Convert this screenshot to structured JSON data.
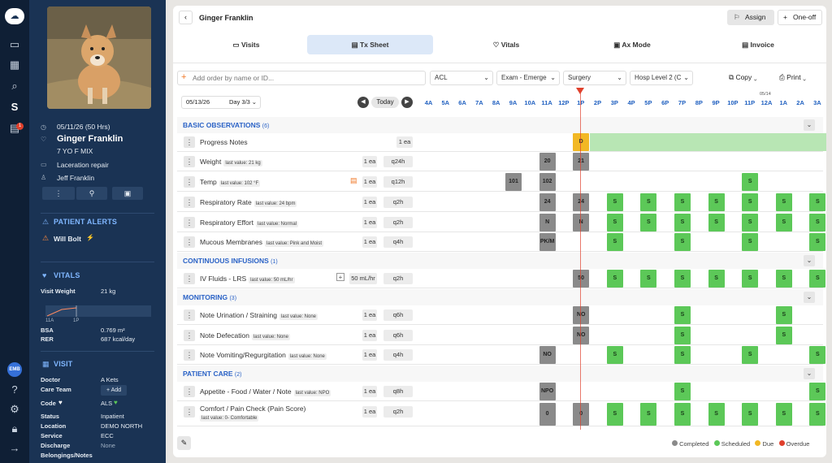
{
  "patient": {
    "datetime": "05/11/26 (50 Hrs)",
    "name": "Ginger Franklin",
    "descriptor": "7 YO F MIX",
    "reason": "Laceration repair",
    "owner": "Jeff Franklin"
  },
  "rail": {
    "badge": "1",
    "user_initials": "EMB"
  },
  "alerts": {
    "title": "PATIENT ALERTS",
    "item": "Will Bolt"
  },
  "vitals": {
    "title": "VITALS",
    "visit_weight_label": "Visit Weight",
    "visit_weight": "21 kg",
    "chart_x": [
      "11A",
      "1P"
    ],
    "bsa_label": "BSA",
    "bsa": "0.769 m²",
    "rer_label": "RER",
    "rer": "687 kcal/day"
  },
  "visit": {
    "title": "VISIT",
    "doctor_label": "Doctor",
    "doctor": "A Kets",
    "careteam_label": "Care Team",
    "careteam_btn": "+ Add",
    "code_label": "Code",
    "code": "ALS",
    "status_label": "Status",
    "status": "Inpatient",
    "location_label": "Location",
    "location": "DEMO NORTH",
    "service_label": "Service",
    "service": "ECC",
    "discharge_label": "Discharge",
    "discharge": "None",
    "belongings_label": "Belongings/Notes"
  },
  "header": {
    "title": "Ginger Franklin",
    "assign": "Assign",
    "oneoff": "One-off"
  },
  "tabs": [
    "Visits",
    "Tx Sheet",
    "Vitals",
    "Ax Mode",
    "Invoice"
  ],
  "toolbar": {
    "add_placeholder": "Add order by name or ID...",
    "filters": [
      "ACL",
      "Exam - Emerge",
      "Surgery",
      "Hosp Level 2 (C"
    ],
    "copy": "Copy",
    "print": "Print"
  },
  "timeline": {
    "date": "05/13/26",
    "day": "Day 3/3",
    "today": "Today",
    "next_date": "05/14",
    "hours": [
      "4A",
      "5A",
      "6A",
      "7A",
      "8A",
      "9A",
      "10A",
      "11A",
      "12P",
      "1P",
      "2P",
      "3P",
      "4P",
      "5P",
      "6P",
      "7P",
      "8P",
      "9P",
      "10P",
      "11P",
      "12A",
      "1A",
      "2A",
      "3A"
    ]
  },
  "groups": [
    {
      "title": "BASIC OBSERVATIONS",
      "count": "(6)"
    },
    {
      "title": "CONTINUOUS INFUSIONS",
      "count": "(1)"
    },
    {
      "title": "MONITORING",
      "count": "(3)"
    },
    {
      "title": "PATIENT CARE",
      "count": "(2)"
    }
  ],
  "rows": [
    {
      "name": "Progress Notes",
      "last": "",
      "qty": "1 ea",
      "freq": ""
    },
    {
      "name": "Weight",
      "last": "last value: 21 kg",
      "qty": "1 ea",
      "freq": "q24h"
    },
    {
      "name": "Temp",
      "last": "last value: 102 °F",
      "qty": "1 ea",
      "freq": "q12h"
    },
    {
      "name": "Respiratory Rate",
      "last": "last value: 24 bpm",
      "qty": "1 ea",
      "freq": "q2h"
    },
    {
      "name": "Respiratory Effort",
      "last": "last value: Normal",
      "qty": "1 ea",
      "freq": "q2h"
    },
    {
      "name": "Mucous Membranes",
      "last": "last value: Pink and Moist",
      "qty": "1 ea",
      "freq": "q4h"
    },
    {
      "name": "IV Fluids - LRS",
      "last": "last value: 50 mL/hr",
      "qty": "50 mL/hr",
      "freq": "q2h"
    },
    {
      "name": "Note Urination / Straining",
      "last": "last value: None",
      "qty": "1 ea",
      "freq": "q6h"
    },
    {
      "name": "Note Defecation",
      "last": "last value: None",
      "qty": "1 ea",
      "freq": "q6h"
    },
    {
      "name": "Note Vomiting/Regurgitation",
      "last": "last value: None",
      "qty": "1 ea",
      "freq": "q4h"
    },
    {
      "name": "Appetite - Food / Water / Note",
      "last": "last value: NPO",
      "qty": "1 ea",
      "freq": "q8h"
    },
    {
      "name": "Comfort / Pain Check (Pain Score)",
      "last": "last value: 0- Comfortable",
      "qty": "1 ea",
      "freq": "q2h"
    }
  ],
  "cells": [
    [
      [
        9,
        "D",
        "due"
      ]
    ],
    [
      [
        7,
        "20",
        "done"
      ],
      [
        9,
        "21",
        "done"
      ]
    ],
    [
      [
        5,
        "101",
        "done"
      ],
      [
        7,
        "102",
        "done"
      ],
      [
        19,
        "S",
        "sch"
      ]
    ],
    [
      [
        7,
        "24",
        "done"
      ],
      [
        9,
        "24",
        "done"
      ],
      [
        11,
        "S",
        "sch"
      ],
      [
        13,
        "S",
        "sch"
      ],
      [
        15,
        "S",
        "sch"
      ],
      [
        17,
        "S",
        "sch"
      ],
      [
        19,
        "S",
        "sch"
      ],
      [
        21,
        "S",
        "sch"
      ],
      [
        23,
        "S",
        "sch"
      ]
    ],
    [
      [
        7,
        "N",
        "done"
      ],
      [
        9,
        "N",
        "done"
      ],
      [
        11,
        "S",
        "sch"
      ],
      [
        13,
        "S",
        "sch"
      ],
      [
        15,
        "S",
        "sch"
      ],
      [
        17,
        "S",
        "sch"
      ],
      [
        19,
        "S",
        "sch"
      ],
      [
        21,
        "S",
        "sch"
      ],
      [
        23,
        "S",
        "sch"
      ]
    ],
    [
      [
        7,
        "PK/M",
        "done"
      ],
      [
        11,
        "S",
        "sch"
      ],
      [
        15,
        "S",
        "sch"
      ],
      [
        19,
        "S",
        "sch"
      ],
      [
        23,
        "S",
        "sch"
      ]
    ],
    [
      [
        9,
        "50",
        "done"
      ],
      [
        11,
        "S",
        "sch"
      ],
      [
        13,
        "S",
        "sch"
      ],
      [
        15,
        "S",
        "sch"
      ],
      [
        17,
        "S",
        "sch"
      ],
      [
        19,
        "S",
        "sch"
      ],
      [
        21,
        "S",
        "sch"
      ],
      [
        23,
        "S",
        "sch"
      ]
    ],
    [
      [
        9,
        "NO",
        "done"
      ],
      [
        15,
        "S",
        "sch"
      ],
      [
        21,
        "S",
        "sch"
      ]
    ],
    [
      [
        9,
        "NO",
        "done"
      ],
      [
        15,
        "S",
        "sch"
      ],
      [
        21,
        "S",
        "sch"
      ]
    ],
    [
      [
        7,
        "NO",
        "done"
      ],
      [
        11,
        "S",
        "sch"
      ],
      [
        15,
        "S",
        "sch"
      ],
      [
        19,
        "S",
        "sch"
      ],
      [
        23,
        "S",
        "sch"
      ]
    ],
    [
      [
        7,
        "NPO",
        "done"
      ],
      [
        15,
        "S",
        "sch"
      ],
      [
        23,
        "S",
        "sch"
      ]
    ],
    [
      [
        7,
        "0",
        "done"
      ],
      [
        9,
        "0",
        "done"
      ],
      [
        11,
        "S",
        "sch"
      ],
      [
        13,
        "S",
        "sch"
      ],
      [
        15,
        "S",
        "sch"
      ],
      [
        17,
        "S",
        "sch"
      ],
      [
        19,
        "S",
        "sch"
      ],
      [
        21,
        "S",
        "sch"
      ],
      [
        23,
        "S",
        "sch"
      ]
    ]
  ],
  "legend": [
    "Completed",
    "Scheduled",
    "Due",
    "Overdue"
  ],
  "colors": {
    "completed": "#8a8a8a",
    "scheduled": "#5cc858",
    "due": "#f2b824",
    "overdue": "#e0402c",
    "accent": "#2a62c6",
    "sidebar": "#1a3354"
  }
}
